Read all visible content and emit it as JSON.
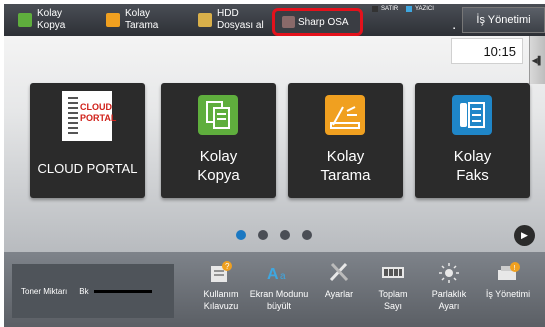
{
  "topbar": {
    "kolay_kopya": "Kolay\nKopya",
    "kolay_tarama": "Kolay\nTarama",
    "hdd": "HDD\nDosyası al",
    "sharp_osa": "Sharp OSA",
    "satir": "SATIR",
    "yazici": "YAZICI",
    "job_status": "İş Yönetimi"
  },
  "clock": "10:15",
  "tiles": [
    {
      "label": "CLOUD PORTAL",
      "icon": "cloud-portal-icon",
      "logo_text": "CLOUD\nPORTAL"
    },
    {
      "label": "Kolay\nKopya",
      "icon": "copy-icon"
    },
    {
      "label": "Kolay\nTarama",
      "icon": "scan-icon"
    },
    {
      "label": "Kolay\nFaks",
      "icon": "fax-icon"
    }
  ],
  "pagination": {
    "pages": 4,
    "current": 1
  },
  "bottombar": {
    "toner_label": "Toner Miktarı",
    "toner_color": "Bk",
    "buttons": [
      {
        "label": "Kullanım\nKılavuzu",
        "icon": "manual-icon"
      },
      {
        "label": "Ekran Modunu\nbüyült",
        "icon": "magnify-mode-icon"
      },
      {
        "label": "Ayarlar",
        "icon": "settings-icon"
      },
      {
        "label": "Toplam\nSayı",
        "icon": "counter-icon"
      },
      {
        "label": "Parlaklık\nAyarı",
        "icon": "brightness-icon"
      },
      {
        "label": "İş Yönetimi",
        "icon": "job-status-icon"
      }
    ]
  },
  "colors": {
    "highlight": "#e4121c",
    "copy": "#5fae3d",
    "scan": "#f0a020",
    "fax": "#1f86c8",
    "dot_active": "#1a78c2"
  }
}
